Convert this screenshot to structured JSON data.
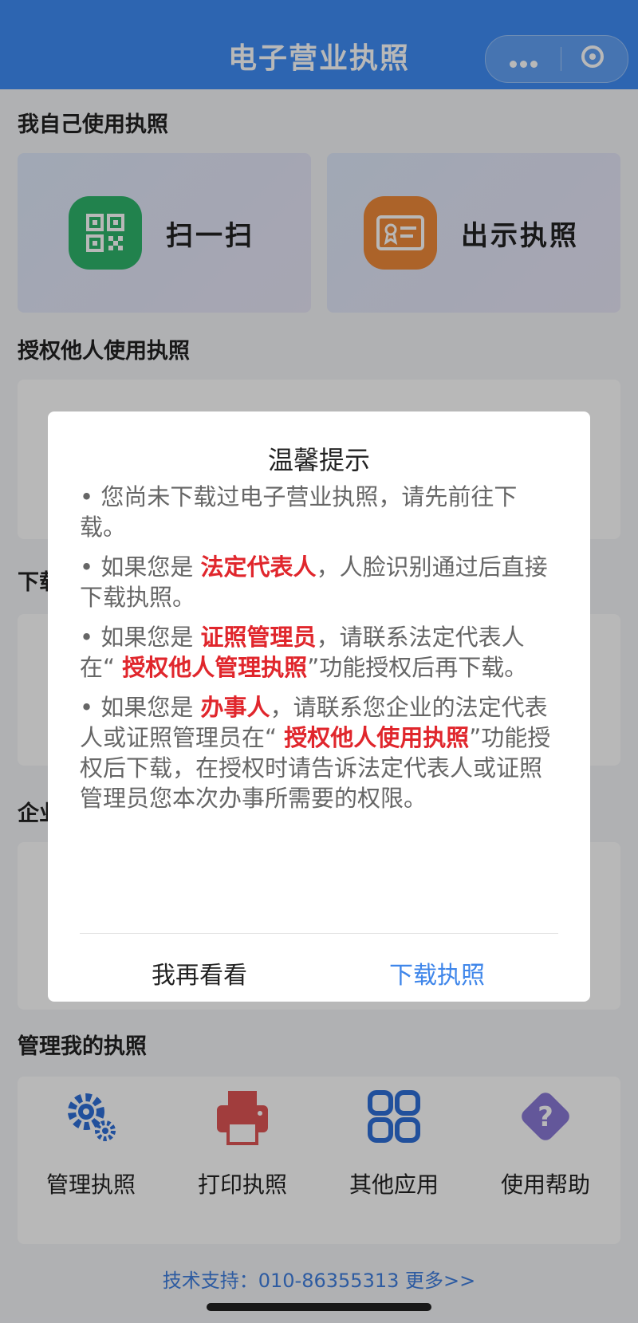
{
  "header": {
    "title": "电子营业执照"
  },
  "sections": {
    "self_use": "我自己使用执照",
    "authorize_use": "授权他人使用执照",
    "download_partial": "下载",
    "enterprise_partial": "企业",
    "manage": "管理我的执照"
  },
  "quick_actions": [
    {
      "label": "扫一扫",
      "icon": "qr-scan-icon",
      "color": "#2fb46b"
    },
    {
      "label": "出示执照",
      "icon": "license-card-icon",
      "color": "#ef8a3a"
    }
  ],
  "tools": [
    {
      "label": "管理执照",
      "icon": "gear-icon"
    },
    {
      "label": "打印执照",
      "icon": "printer-icon"
    },
    {
      "label": "其他应用",
      "icon": "apps-grid-icon"
    },
    {
      "label": "使用帮助",
      "icon": "help-icon"
    }
  ],
  "footer": {
    "text": "技术支持：010-86355313   更多>>"
  },
  "dialog": {
    "title": "温馨提示",
    "p1": "• 您尚未下载过电子营业执照，请先前往下载。",
    "p2_a": "• 如果您是 ",
    "p2_hl": "法定代表人",
    "p2_b": "，人脸识别通过后直接下载执照。",
    "p3_a": "• 如果您是 ",
    "p3_hl": "证照管理员",
    "p3_b": "，请联系法定代表人在“ ",
    "p3_hl2": "授权他人管理执照",
    "p3_c": "”功能授权后再下载。",
    "p4_a": "• 如果您是 ",
    "p4_hl": "办事人",
    "p4_b": "，请联系您企业的法定代表人或证照管理员在“ ",
    "p4_hl2": "授权他人使用执照",
    "p4_c": "”功能授权后下载，在授权时请告诉法定代表人或证照管理员您本次办事所需要的权限。",
    "cancel": "我再看看",
    "confirm": "下载执照"
  },
  "colors": {
    "brand": "#3f8df5",
    "highlight": "#e0262c",
    "link": "#3f86ea"
  }
}
